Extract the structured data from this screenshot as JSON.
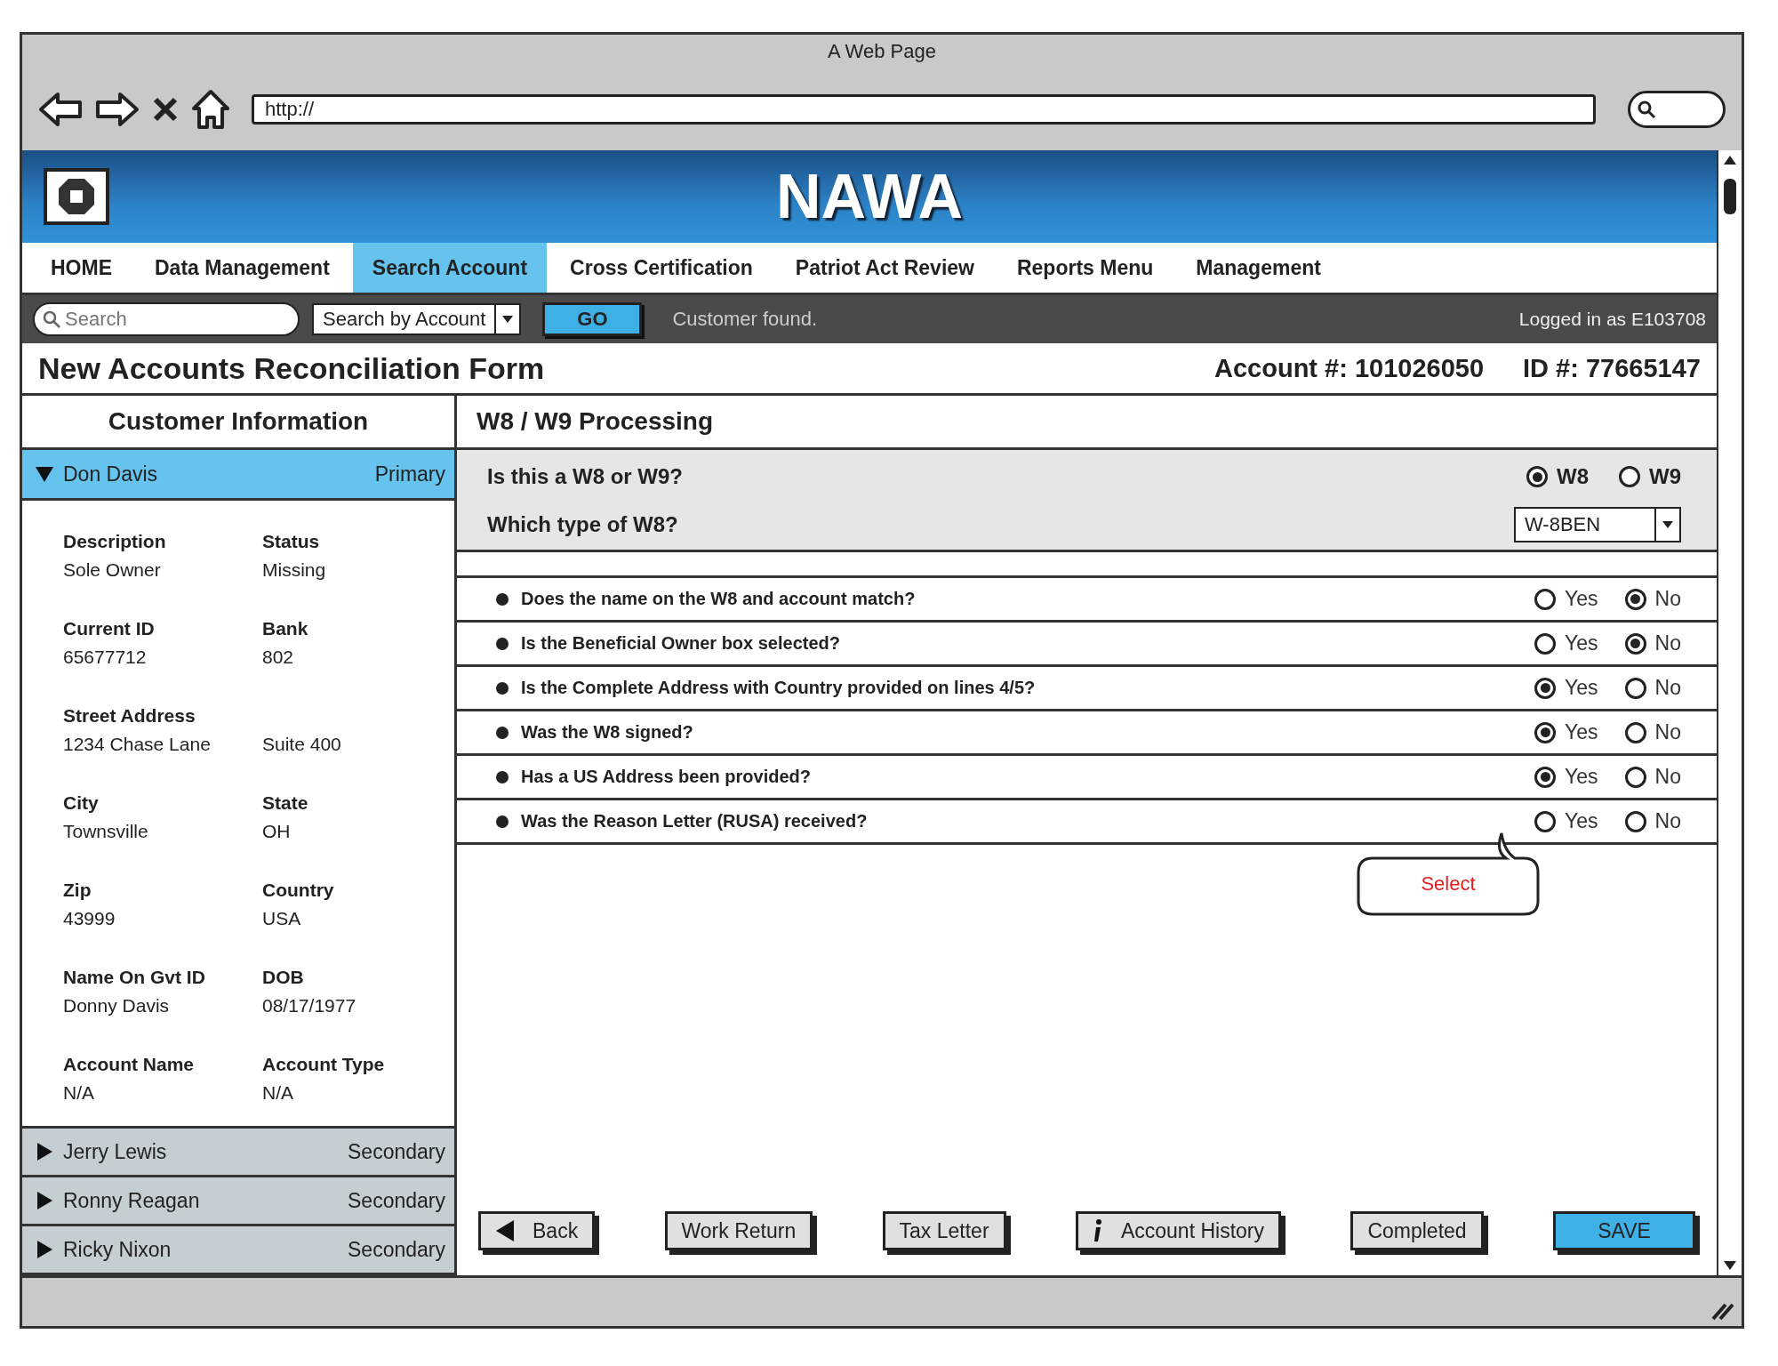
{
  "browser": {
    "title": "A Web Page",
    "url": "http://"
  },
  "header": {
    "title": "NAWA"
  },
  "nav": [
    {
      "label": "HOME",
      "selected": false
    },
    {
      "label": "Data Management",
      "selected": false
    },
    {
      "label": "Search Account",
      "selected": true
    },
    {
      "label": "Cross Certification",
      "selected": false
    },
    {
      "label": "Patriot Act Review",
      "selected": false
    },
    {
      "label": "Reports Menu",
      "selected": false
    },
    {
      "label": "Management",
      "selected": false
    }
  ],
  "toolbar": {
    "search": {
      "placeholder": "Search"
    },
    "search_by": {
      "value": "Search by Account"
    },
    "go_button": "GO",
    "status": "Customer found.",
    "logged_in": "Logged in as E103708"
  },
  "form": {
    "title": "New Accounts Reconciliation Form",
    "account": "Account #: 101026050",
    "id": "ID #: 77665147"
  },
  "customer_panel": {
    "title": "Customer Information",
    "customers": [
      {
        "name": "Don Davis",
        "role": "Primary",
        "expanded": true,
        "fields": [
          {
            "label": "Description",
            "value": "Sole Owner"
          },
          {
            "label": "Status",
            "value": "Missing"
          },
          {
            "label": "Current ID",
            "value": "65677712"
          },
          {
            "label": "Bank",
            "value": "802"
          },
          {
            "label": "Street Address",
            "value": "1234 Chase Lane"
          },
          {
            "value": "Suite 400"
          },
          {
            "label": "City",
            "value": "Townsville"
          },
          {
            "label": "State",
            "value": "OH"
          },
          {
            "label": "Zip",
            "value": "43999"
          },
          {
            "label": "Country",
            "value": "USA"
          },
          {
            "label": "Name On Gvt ID",
            "value": "Donny Davis"
          },
          {
            "label": "DOB",
            "value": "08/17/1977"
          },
          {
            "label": "Account Name",
            "value": "N/A"
          },
          {
            "label": "Account Type",
            "value": "N/A"
          }
        ]
      },
      {
        "name": "Jerry Lewis",
        "role": "Secondary",
        "expanded": false
      },
      {
        "name": "Ronny Reagan",
        "role": "Secondary",
        "expanded": false
      },
      {
        "name": "Ricky Nixon",
        "role": "Secondary",
        "expanded": false
      }
    ]
  },
  "processing": {
    "title": "W8 / W9 Processing",
    "type_question": {
      "text": "Is this a W8 or W9?",
      "options": [
        {
          "label": "W8",
          "selected": true
        },
        {
          "label": "W9",
          "selected": false
        }
      ]
    },
    "subtype_question": {
      "text": "Which type of W8?",
      "value": "W-8BEN"
    },
    "questions": [
      {
        "text": "Does the name on the W8 and account match?",
        "options": [
          {
            "label": "Yes",
            "selected": false
          },
          {
            "label": "No",
            "selected": true
          }
        ]
      },
      {
        "text": "Is the Beneficial Owner box selected?",
        "options": [
          {
            "label": "Yes",
            "selected": false
          },
          {
            "label": "No",
            "selected": true
          }
        ]
      },
      {
        "text": "Is the Complete Address with Country provided on lines 4/5?",
        "options": [
          {
            "label": "Yes",
            "selected": true
          },
          {
            "label": "No",
            "selected": false
          }
        ]
      },
      {
        "text": "Was the W8 signed?",
        "options": [
          {
            "label": "Yes",
            "selected": true
          },
          {
            "label": "No",
            "selected": false
          }
        ]
      },
      {
        "text": "Has a US Address been provided?",
        "options": [
          {
            "label": "Yes",
            "selected": true
          },
          {
            "label": "No",
            "selected": false
          }
        ]
      },
      {
        "text": "Was the Reason Letter (RUSA) received?",
        "options": [
          {
            "label": "Yes",
            "selected": false
          },
          {
            "label": "No",
            "selected": false
          }
        ]
      }
    ],
    "tooltip": {
      "text": "Select"
    }
  },
  "buttons": [
    {
      "label": "Back",
      "kind": "back"
    },
    {
      "label": "Work Return",
      "kind": "plain"
    },
    {
      "label": "Tax Letter",
      "kind": "plain"
    },
    {
      "label": "Account History",
      "kind": "info"
    },
    {
      "label": "Completed",
      "kind": "plain"
    },
    {
      "label": "SAVE",
      "kind": "primary"
    }
  ]
}
